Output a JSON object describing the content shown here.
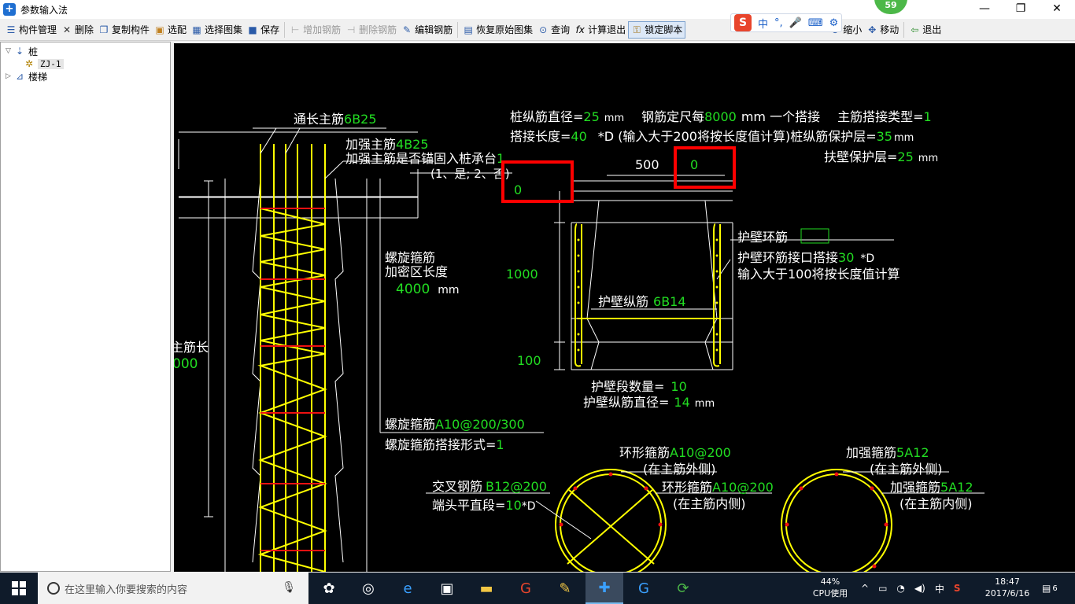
{
  "window": {
    "title": "参数输入法",
    "badge_count": "59",
    "minimize": "—",
    "maximize": "❐",
    "close": "✕"
  },
  "toolbar": [
    {
      "label": "构件管理",
      "icon": "list-icon"
    },
    {
      "label": "删除",
      "icon": "close-icon"
    },
    {
      "label": "复制构件",
      "icon": "copy-icon"
    },
    {
      "label": "选配",
      "icon": "select-icon"
    },
    {
      "label": "选择图集",
      "icon": "gallery-icon"
    },
    {
      "label": "保存",
      "icon": "save-icon"
    },
    {
      "label": "增加钢筋",
      "icon": "add-rebar-icon",
      "disabled": true
    },
    {
      "label": "删除钢筋",
      "icon": "delete-rebar-icon",
      "disabled": true
    },
    {
      "label": "编辑钢筋",
      "icon": "edit-rebar-icon"
    },
    {
      "label": "恢复原始图集",
      "icon": "restore-icon"
    },
    {
      "label": "查询",
      "icon": "binoculars-icon"
    },
    {
      "label": "计算退出",
      "icon": "fx-icon"
    },
    {
      "label": "锁定脚本",
      "icon": "lock-icon",
      "pressed": true
    },
    {
      "label": "缩小",
      "icon": "zoom-out-icon"
    },
    {
      "label": "移动",
      "icon": "move-icon"
    },
    {
      "label": "退出",
      "icon": "exit-icon"
    }
  ],
  "ime": {
    "logo": "S",
    "lang": "中",
    "punct": "°,",
    "mic": "🎤",
    "kbd": "⌨",
    "extra": "⚙"
  },
  "tree": {
    "root": "桩",
    "child": "ZJ-1",
    "sibling": "楼梯"
  },
  "drawing": {
    "top_params": {
      "l1_a": "桩纵筋直径=",
      "l1_a_val": "25",
      "l1_a_unit": "mm",
      "l1_b": "钢筋定尺每",
      "l1_b_val": "8000",
      "l1_b_unit": "mm 一个搭接",
      "l1_c": "主筋搭接类型=",
      "l1_c_val": "1",
      "l2_a": "搭接长度=",
      "l2_a_val": "40",
      "l2_b": "*D (输入大于200将按长度值计算)桩纵筋保护层=",
      "l2_b_val": "35",
      "l2_b_unit": "mm",
      "l3_a": "扶壁保护层=",
      "l3_a_val": "25",
      "l3_a_unit": "mm"
    },
    "left": {
      "main_bar": "通长主筋",
      "main_bar_val": "6B25",
      "strong_bar": "加强主筋",
      "strong_bar_val": "4B25",
      "anchor_q": "加强主筋是否锚固入桩承台",
      "anchor_val": "1",
      "anchor_opts": "(1、是; 2、否)",
      "spiral": "螺旋箍筋",
      "dense_len": "加密区长度",
      "dense_val": "4000",
      "dense_unit": "mm",
      "total_len": "主筋长",
      "total_val": "000",
      "spiral_spec_lbl": "螺旋箍筋",
      "spiral_spec_val": "A10@200/300",
      "spiral_lap_lbl": "螺旋箍筋搭接形式=",
      "spiral_lap_val": "1"
    },
    "mid": {
      "field_a": "0",
      "field_b": "0",
      "width": "500",
      "h1": "1000",
      "h2": "100",
      "wall_ring": "护壁环筋",
      "wall_lap": "护壁环筋接口搭接",
      "wall_lap_val": "30",
      "wall_lap_unit": "*D",
      "wall_lap_note": "输入大于100将按长度值计算",
      "wall_long": "护壁纵筋",
      "wall_long_val": "6B14",
      "seg_count_lbl": "护壁段数量=",
      "seg_count_val": "10",
      "wall_dia_lbl": "护壁纵筋直径=",
      "wall_dia_val": "14",
      "wall_dia_unit": "mm"
    },
    "bottom": {
      "cross_lbl": "交叉钢筋",
      "cross_val": "B12@200",
      "end_lbl": "端头平直段=",
      "end_val": "10",
      "end_unit": "*D",
      "ring_out_lbl": "环形箍筋",
      "ring_out_val": "A10@200",
      "ring_out_note": "(在主筋外侧)",
      "ring_in_lbl": "环形箍筋",
      "ring_in_val": "A10@200",
      "ring_in_note": "(在主筋内侧)",
      "str_out_lbl": "加强箍筋",
      "str_out_val": "5A12",
      "str_out_note": "(在主筋外侧)",
      "str_in_lbl": "加强箍筋",
      "str_in_val": "5A12",
      "str_in_note": "(在主筋内侧)"
    },
    "colors": {
      "white": "#ffffff",
      "green": "#22dd22",
      "yellow": "#ffff00",
      "red": "#ee1111",
      "highlight": "#ff0000"
    }
  },
  "taskbar": {
    "search_placeholder": "在这里输入你要搜索的内容",
    "cpu_pct": "44%",
    "cpu_lbl": "CPU使用",
    "tray_lang": "中",
    "time": "18:47",
    "date": "2017/6/16",
    "notif_count": "6"
  }
}
